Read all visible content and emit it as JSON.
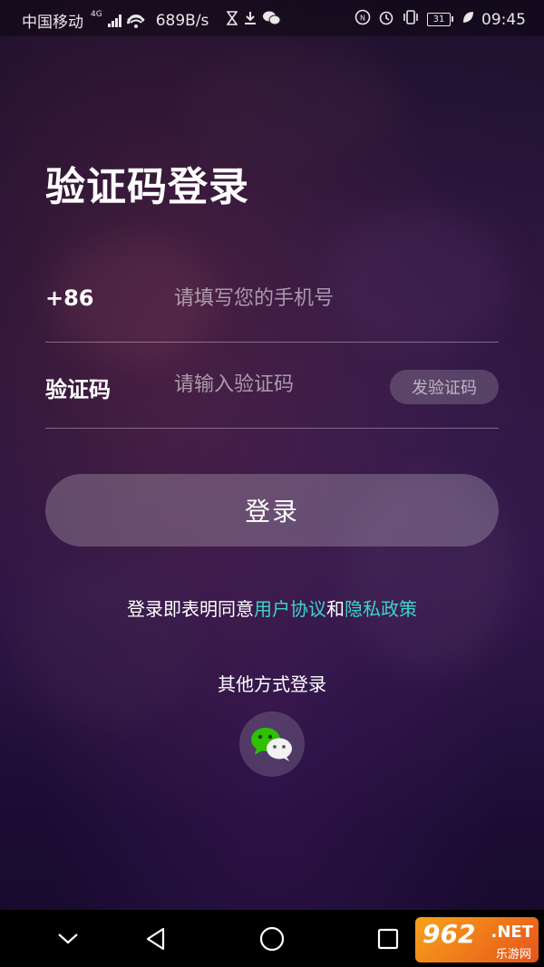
{
  "status_bar": {
    "carrier": "中国移动",
    "network": "4G",
    "speed": "689B/s",
    "battery": "31",
    "time": "09:45"
  },
  "page": {
    "title": "验证码登录"
  },
  "phone_row": {
    "label": "+86",
    "placeholder": "请填写您的手机号"
  },
  "code_row": {
    "label": "验证码",
    "placeholder": "请输入验证码",
    "send_button": "发验证码"
  },
  "login_button": "登录",
  "agreement": {
    "prefix": "登录即表明同意",
    "user_agreement": "用户协议",
    "and": "和",
    "privacy_policy": "隐私政策"
  },
  "other_login": {
    "title": "其他方式登录",
    "icon": "wechat-icon"
  },
  "colors": {
    "link": "#3fd3c8",
    "wechat_green": "#2dc100"
  },
  "nav_bar": {
    "icons": [
      "chevron-down-icon",
      "back-icon",
      "home-icon",
      "recent-apps-icon"
    ]
  },
  "watermark": {
    "main": "962",
    "net": ".NET",
    "sub": "乐游网"
  }
}
